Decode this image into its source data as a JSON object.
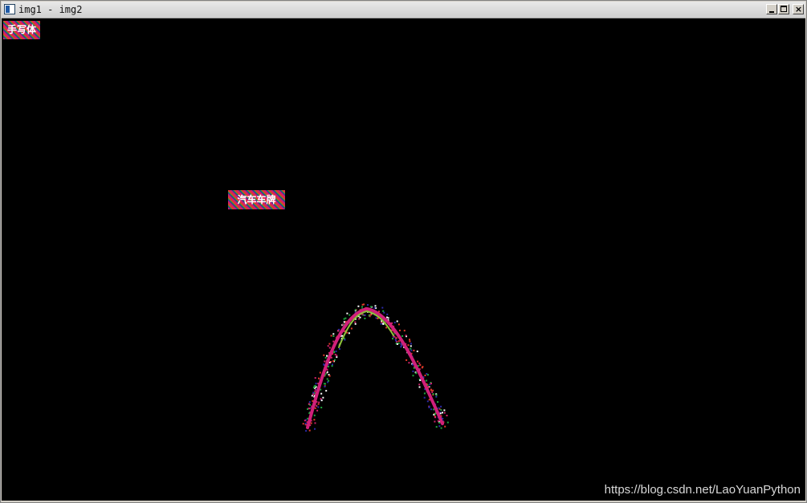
{
  "window": {
    "title": "img1 - img2",
    "controls": {
      "minimize_glyph": "",
      "maximize_glyph": "",
      "close_glyph": "×"
    }
  },
  "canvas": {
    "background": "#000000",
    "labels": [
      {
        "text": "手写体"
      },
      {
        "text": "汽车车牌"
      }
    ],
    "curve_colors": {
      "main": "#d0207a",
      "highlight": "#8fc23a",
      "noise": [
        "#d0206a",
        "#2a2aa8",
        "#1ea63c",
        "#e23a2a",
        "#ffffff"
      ]
    }
  },
  "watermark": "https://blog.csdn.net/LaoYuanPython"
}
